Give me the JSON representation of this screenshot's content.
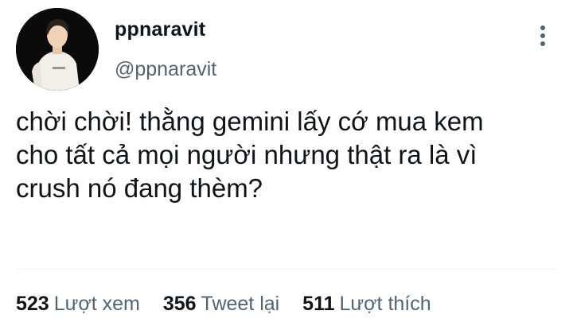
{
  "tweet": {
    "author": {
      "display_name": "ppnaravit",
      "handle": "@ppnaravit",
      "avatar_icon": "profile-photo"
    },
    "more_icon": "more-vertical-icon",
    "text_lines": [
      "chời chời! thằng gemini lấy cớ mua kem",
      "cho tất cả mọi người nhưng thật ra là vì",
      "crush nó đang thèm?"
    ],
    "stats": {
      "views": {
        "count": "523",
        "label": "Lượt xem"
      },
      "retweets": {
        "count": "356",
        "label": "Tweet lại"
      },
      "likes": {
        "count": "511",
        "label": "Lượt thích"
      }
    }
  },
  "colors": {
    "text_primary": "#0f1419",
    "text_secondary": "#536471",
    "divider": "#eff3f4",
    "avatar_background": "#0b0b0b"
  }
}
